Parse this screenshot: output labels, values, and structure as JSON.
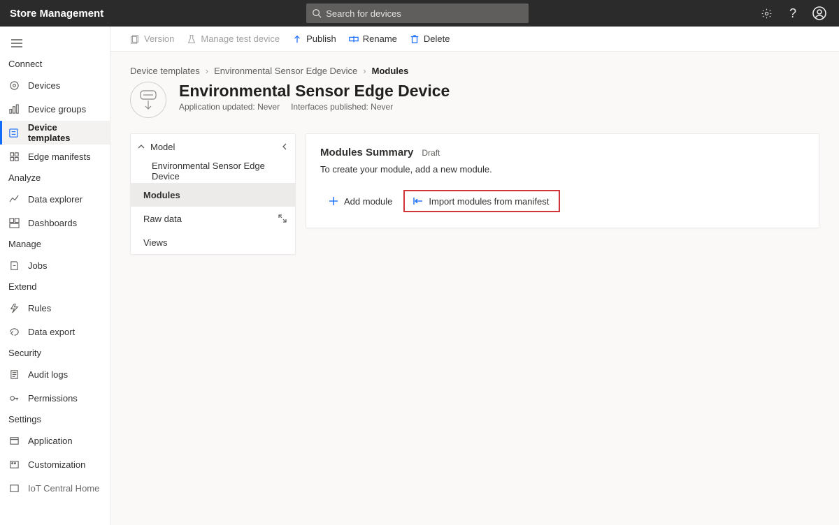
{
  "brand": {
    "title": "Store Management"
  },
  "search": {
    "placeholder": "Search for devices"
  },
  "sidebar": {
    "groups": [
      {
        "label": "Connect",
        "items": [
          {
            "name": "devices",
            "label": "Devices"
          },
          {
            "name": "device-groups",
            "label": "Device groups"
          },
          {
            "name": "device-templates",
            "label": "Device templates",
            "active": true
          },
          {
            "name": "edge-manifests",
            "label": "Edge manifests"
          }
        ]
      },
      {
        "label": "Analyze",
        "items": [
          {
            "name": "data-explorer",
            "label": "Data explorer"
          },
          {
            "name": "dashboards",
            "label": "Dashboards"
          }
        ]
      },
      {
        "label": "Manage",
        "items": [
          {
            "name": "jobs",
            "label": "Jobs"
          }
        ]
      },
      {
        "label": "Extend",
        "items": [
          {
            "name": "rules",
            "label": "Rules"
          },
          {
            "name": "data-export",
            "label": "Data export"
          }
        ]
      },
      {
        "label": "Security",
        "items": [
          {
            "name": "audit-logs",
            "label": "Audit logs"
          },
          {
            "name": "permissions",
            "label": "Permissions"
          }
        ]
      },
      {
        "label": "Settings",
        "items": [
          {
            "name": "application",
            "label": "Application"
          },
          {
            "name": "customization",
            "label": "Customization"
          },
          {
            "name": "iot-central-home",
            "label": "IoT Central Home"
          }
        ]
      }
    ]
  },
  "commandbar": {
    "version": "Version",
    "manage_test_device": "Manage test device",
    "publish": "Publish",
    "rename": "Rename",
    "delete": "Delete"
  },
  "breadcrumb": {
    "root": "Device templates",
    "mid": "Environmental Sensor Edge Device",
    "leaf": "Modules"
  },
  "header": {
    "title": "Environmental Sensor Edge Device",
    "app_updated": "Application updated: Never",
    "interfaces_published": "Interfaces published: Never"
  },
  "tree": {
    "root": "Model",
    "device": "Environmental Sensor Edge Device",
    "modules": "Modules",
    "raw_data": "Raw data",
    "views": "Views"
  },
  "modules_panel": {
    "title": "Modules Summary",
    "status": "Draft",
    "hint": "To create your module, add a new module.",
    "add_module": "Add module",
    "import_modules": "Import modules from manifest"
  }
}
